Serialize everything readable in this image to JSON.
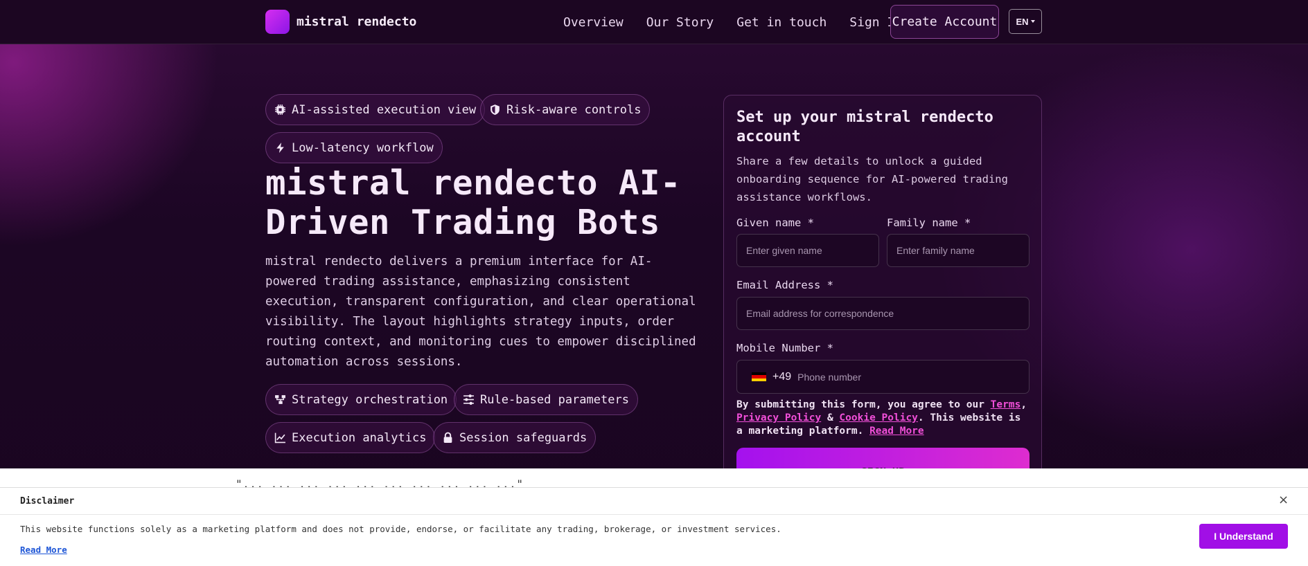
{
  "nav": {
    "brand": "mistral rendecto",
    "links": [
      "Overview",
      "Our Story",
      "Get in touch",
      "Sign In"
    ],
    "cta": "Create Account",
    "language": "EN"
  },
  "hero": {
    "badges": [
      "AI-assisted execution view",
      "Risk-aware controls",
      "Low-latency workflow"
    ],
    "title": "mistral rendecto AI-Driven Trading Bots",
    "description": "mistral rendecto delivers a premium interface for AI-powered trading assistance, emphasizing consistent execution, transparent configuration, and clear operational visibility. The layout highlights strategy inputs, order routing context, and monitoring cues to empower disciplined automation across sessions.",
    "features": [
      "Strategy orchestration",
      "Rule-based parameters",
      "Execution analytics",
      "Session safeguards"
    ]
  },
  "form": {
    "title": "Set up your mistral rendecto account",
    "subtitle": "Share a few details to unlock a guided onboarding sequence for AI-powered trading assistance workflows.",
    "given_label": "Given name *",
    "given_placeholder": "Enter given name",
    "family_label": "Family name *",
    "family_placeholder": "Enter family name",
    "email_label": "Email Address *",
    "email_placeholder": "Email address for correspondence",
    "phone_label": "Mobile Number *",
    "dial_code": "+49",
    "phone_placeholder": "Phone number",
    "consent_prefix": "By submitting this form, you agree to our ",
    "terms": "Terms",
    "comma": ",",
    "privacy": "Privacy Policy",
    "amp": " & ",
    "cookie": "Cookie Policy",
    "consent_suffix": ". This website is a marketing platform. ",
    "read_more": "Read More",
    "submit": "SIGN UP"
  },
  "behind_text": "\"... ... ... ... ... ... ... ... ... ...\"",
  "disclaimer": {
    "title": "Disclaimer",
    "text": "This website functions solely as a marketing platform and does not provide, endorse, or facilitate any trading, brokerage, or investment services.",
    "read_more": "Read More",
    "button": "I Understand",
    "close": "×"
  }
}
